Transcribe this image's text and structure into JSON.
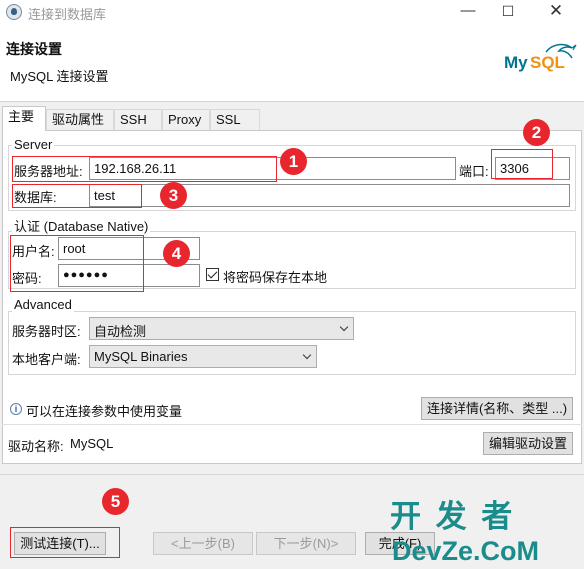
{
  "window": {
    "title": "连接到数据库",
    "minimize_icon": "minimize-icon",
    "maximize_icon": "maximize-icon",
    "close_icon": "close-icon"
  },
  "header": {
    "title": "连接设置",
    "subtitle": "MySQL 连接设置",
    "logo_text": "MySQL"
  },
  "tabs": [
    {
      "label": "主要",
      "active": true
    },
    {
      "label": "驱动属性",
      "active": false
    },
    {
      "label": "SSH",
      "active": false
    },
    {
      "label": "Proxy",
      "active": false
    },
    {
      "label": "SSL",
      "active": false
    }
  ],
  "server": {
    "legend": "Server",
    "host_label": "服务器地址:",
    "host_value": "192.168.26.11",
    "port_label": "端口:",
    "port_value": "3306",
    "db_label": "数据库:",
    "db_value": "test"
  },
  "auth": {
    "legend": "认证 (Database Native)",
    "user_label": "用户名:",
    "user_value": "root",
    "password_label": "密码:",
    "password_value": "●●●●●●",
    "save_password_label": "将密码保存在本地",
    "save_password_checked": true
  },
  "advanced": {
    "legend": "Advanced",
    "timezone_label": "服务器时区:",
    "timezone_value": "自动检测",
    "client_label": "本地客户端:",
    "client_value": "MySQL Binaries"
  },
  "info": {
    "text": "可以在连接参数中使用变量",
    "details_button": "连接详情(名称、类型 ...)"
  },
  "driver": {
    "label": "驱动名称:",
    "value": "MySQL",
    "edit_button": "编辑驱动设置"
  },
  "footer": {
    "test_button": "测试连接(T)...",
    "back_button": "<上一步(B)",
    "next_button": "下一步(N)>",
    "finish_button": "完成(F)"
  },
  "annotations": [
    "1",
    "2",
    "3",
    "4",
    "5"
  ],
  "watermark": {
    "line1": "开 发 者",
    "line2": "DevZe.CoM"
  },
  "colors": {
    "annotation_red": "#e8262d",
    "mysql_blue": "#00758f",
    "mysql_orange": "#f29111"
  }
}
